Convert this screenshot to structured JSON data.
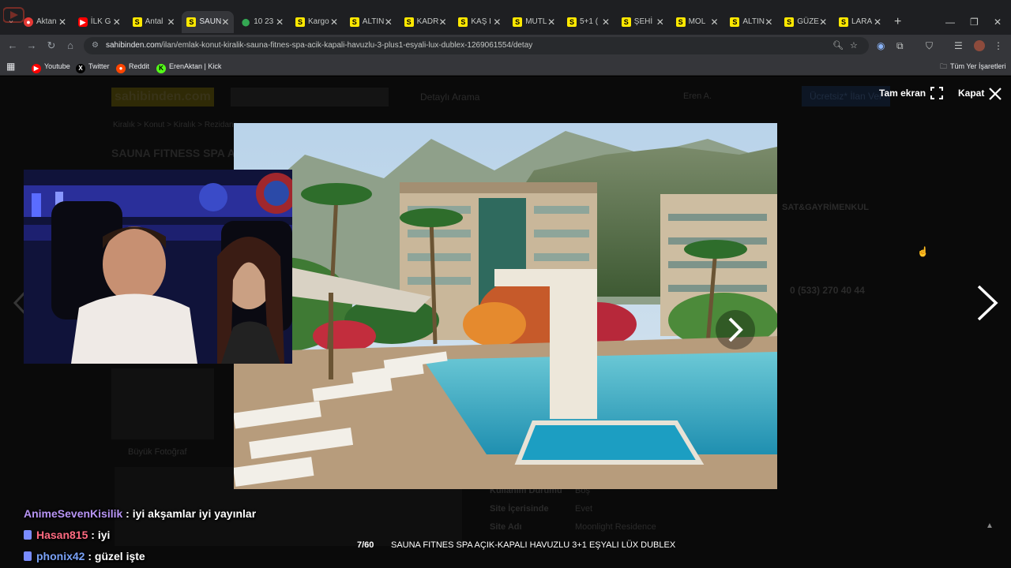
{
  "browser": {
    "tabs": [
      {
        "label": "Aktan",
        "icon": "reddit-like-icon",
        "active": false
      },
      {
        "label": "İLK G",
        "icon": "youtube-icon",
        "active": false
      },
      {
        "label": "Antal",
        "icon": "sahibinden-icon",
        "active": false
      },
      {
        "label": "SAUN",
        "icon": "sahibinden-icon",
        "active": true
      },
      {
        "label": "10 23",
        "icon": "maps-pin-icon",
        "active": false
      },
      {
        "label": "Kargo",
        "icon": "sahibinden-icon",
        "active": false
      },
      {
        "label": "ALTIN",
        "icon": "sahibinden-icon",
        "active": false
      },
      {
        "label": "KADR",
        "icon": "sahibinden-icon",
        "active": false
      },
      {
        "label": "KAŞ I",
        "icon": "sahibinden-icon",
        "active": false
      },
      {
        "label": "MUTL",
        "icon": "sahibinden-icon",
        "active": false
      },
      {
        "label": "5+1 (",
        "icon": "sahibinden-icon",
        "active": false
      },
      {
        "label": "ŞEHİ",
        "icon": "sahibinden-icon",
        "active": false
      },
      {
        "label": "MOL",
        "icon": "sahibinden-icon",
        "active": false
      },
      {
        "label": "ALTIN",
        "icon": "sahibinden-icon",
        "active": false
      },
      {
        "label": "GÜZE",
        "icon": "sahibinden-icon",
        "active": false
      },
      {
        "label": "LARA",
        "icon": "sahibinden-icon",
        "active": false
      }
    ],
    "url_host": "sahibinden.com",
    "url_path": "/ilan/emlak-konut-kiralik-sauna-fitnes-spa-acik-kapali-havuzlu-3-plus1-esyali-lux-dublex-1269061554/detay",
    "bookmarks": [
      {
        "label": "Youtube",
        "icon": "youtube-icon",
        "color": "#ff0000",
        "glyph": "▶"
      },
      {
        "label": "Twitter",
        "icon": "x-icon",
        "color": "#000000",
        "glyph": "X"
      },
      {
        "label": "Reddit",
        "icon": "reddit-icon",
        "color": "#ff4500",
        "glyph": "●"
      },
      {
        "label": "ErenAktan | Kick",
        "icon": "kick-icon",
        "color": "#53fc18",
        "glyph": "K"
      }
    ],
    "all_bookmarks_label": "Tüm Yer İşaretleri"
  },
  "page_bg": {
    "logo": "sahibinden.com",
    "detailed_search": "Detaylı Arama",
    "user": "Eren A.",
    "post_ad": "Ücretsiz* İlan Ver",
    "title_fragment": "SAUNA FITNESS SPA A",
    "breadcrumb": "Kiralık > Konut > Kiralık > Rezidans",
    "office": "SAT&GAYRİMENKUL",
    "phone": "0 (533) 270 40 44",
    "big_photo": "Büyük Fotoğraf",
    "rows": [
      {
        "k": "Kullanım Durumu",
        "v": "Boş"
      },
      {
        "k": "Site İçerisinde",
        "v": "Evet"
      },
      {
        "k": "Site Adı",
        "v": "Moonlight Residence"
      }
    ]
  },
  "gallery": {
    "fullscreen_label": "Tam ekran",
    "close_label": "Kapat",
    "counter": "7/60",
    "caption": "SAUNA FITNES SPA AÇIK-KAPALI HAVUZLU 3+1 EŞYALI LÜX DUBLEX"
  },
  "chat": [
    {
      "user": "AnimeSevenKisilik",
      "message": " : iyi akşamlar iyi yayınlar",
      "color": "#b794f4"
    },
    {
      "user": "Hasan815",
      "message": " : iyi",
      "color": "#ff6b81"
    },
    {
      "user": "phonix42",
      "message": " : güzel işte",
      "color": "#7aa2f7"
    }
  ],
  "colors": {
    "accent_yellow": "#ffe800",
    "chrome_bg": "#35363a",
    "tab_strip": "#1e1f22"
  }
}
